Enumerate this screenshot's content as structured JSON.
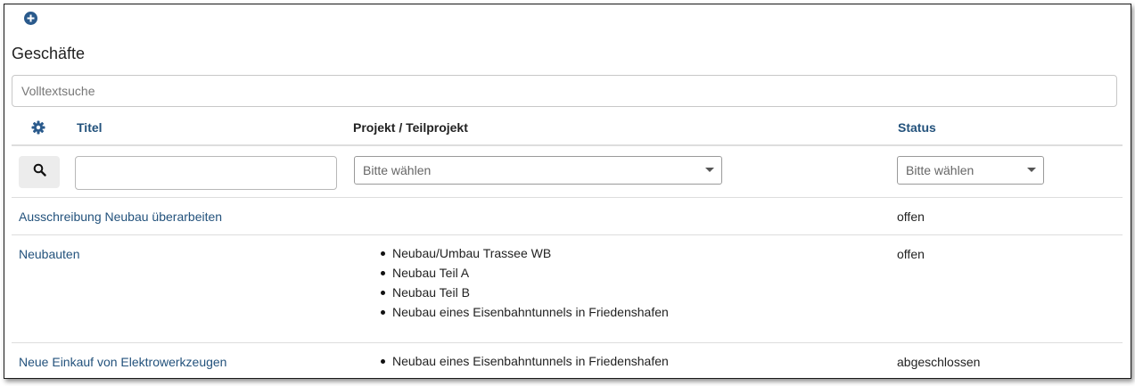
{
  "toolbar": {
    "add_icon": "plus-circle-icon"
  },
  "page": {
    "title": "Geschäfte"
  },
  "search": {
    "placeholder": "Volltextsuche",
    "value": ""
  },
  "table": {
    "settings_icon": "gear-icon",
    "headers": {
      "title": "Titel",
      "project": "Projekt / Teilprojekt",
      "status": "Status"
    },
    "filters": {
      "search_icon": "search-icon",
      "title_value": "",
      "project_select": "Bitte wählen",
      "status_select": "Bitte wählen"
    },
    "rows": [
      {
        "title": "Ausschreibung Neubau überarbeiten",
        "projects": [],
        "status": "offen"
      },
      {
        "title": "Neubauten",
        "projects": [
          "Neubau/Umbau Trassee WB",
          "Neubau Teil A",
          "Neubau Teil B",
          "Neubau eines Eisenbahntunnels in Friedenshafen"
        ],
        "status": "offen"
      },
      {
        "title": "Neue Einkauf von Elektrowerkzeugen",
        "projects": [
          "Neubau eines Eisenbahntunnels in Friedenshafen"
        ],
        "status": "abgeschlossen"
      }
    ]
  },
  "colors": {
    "link": "#23527c",
    "accent": "#2a5a8c"
  }
}
